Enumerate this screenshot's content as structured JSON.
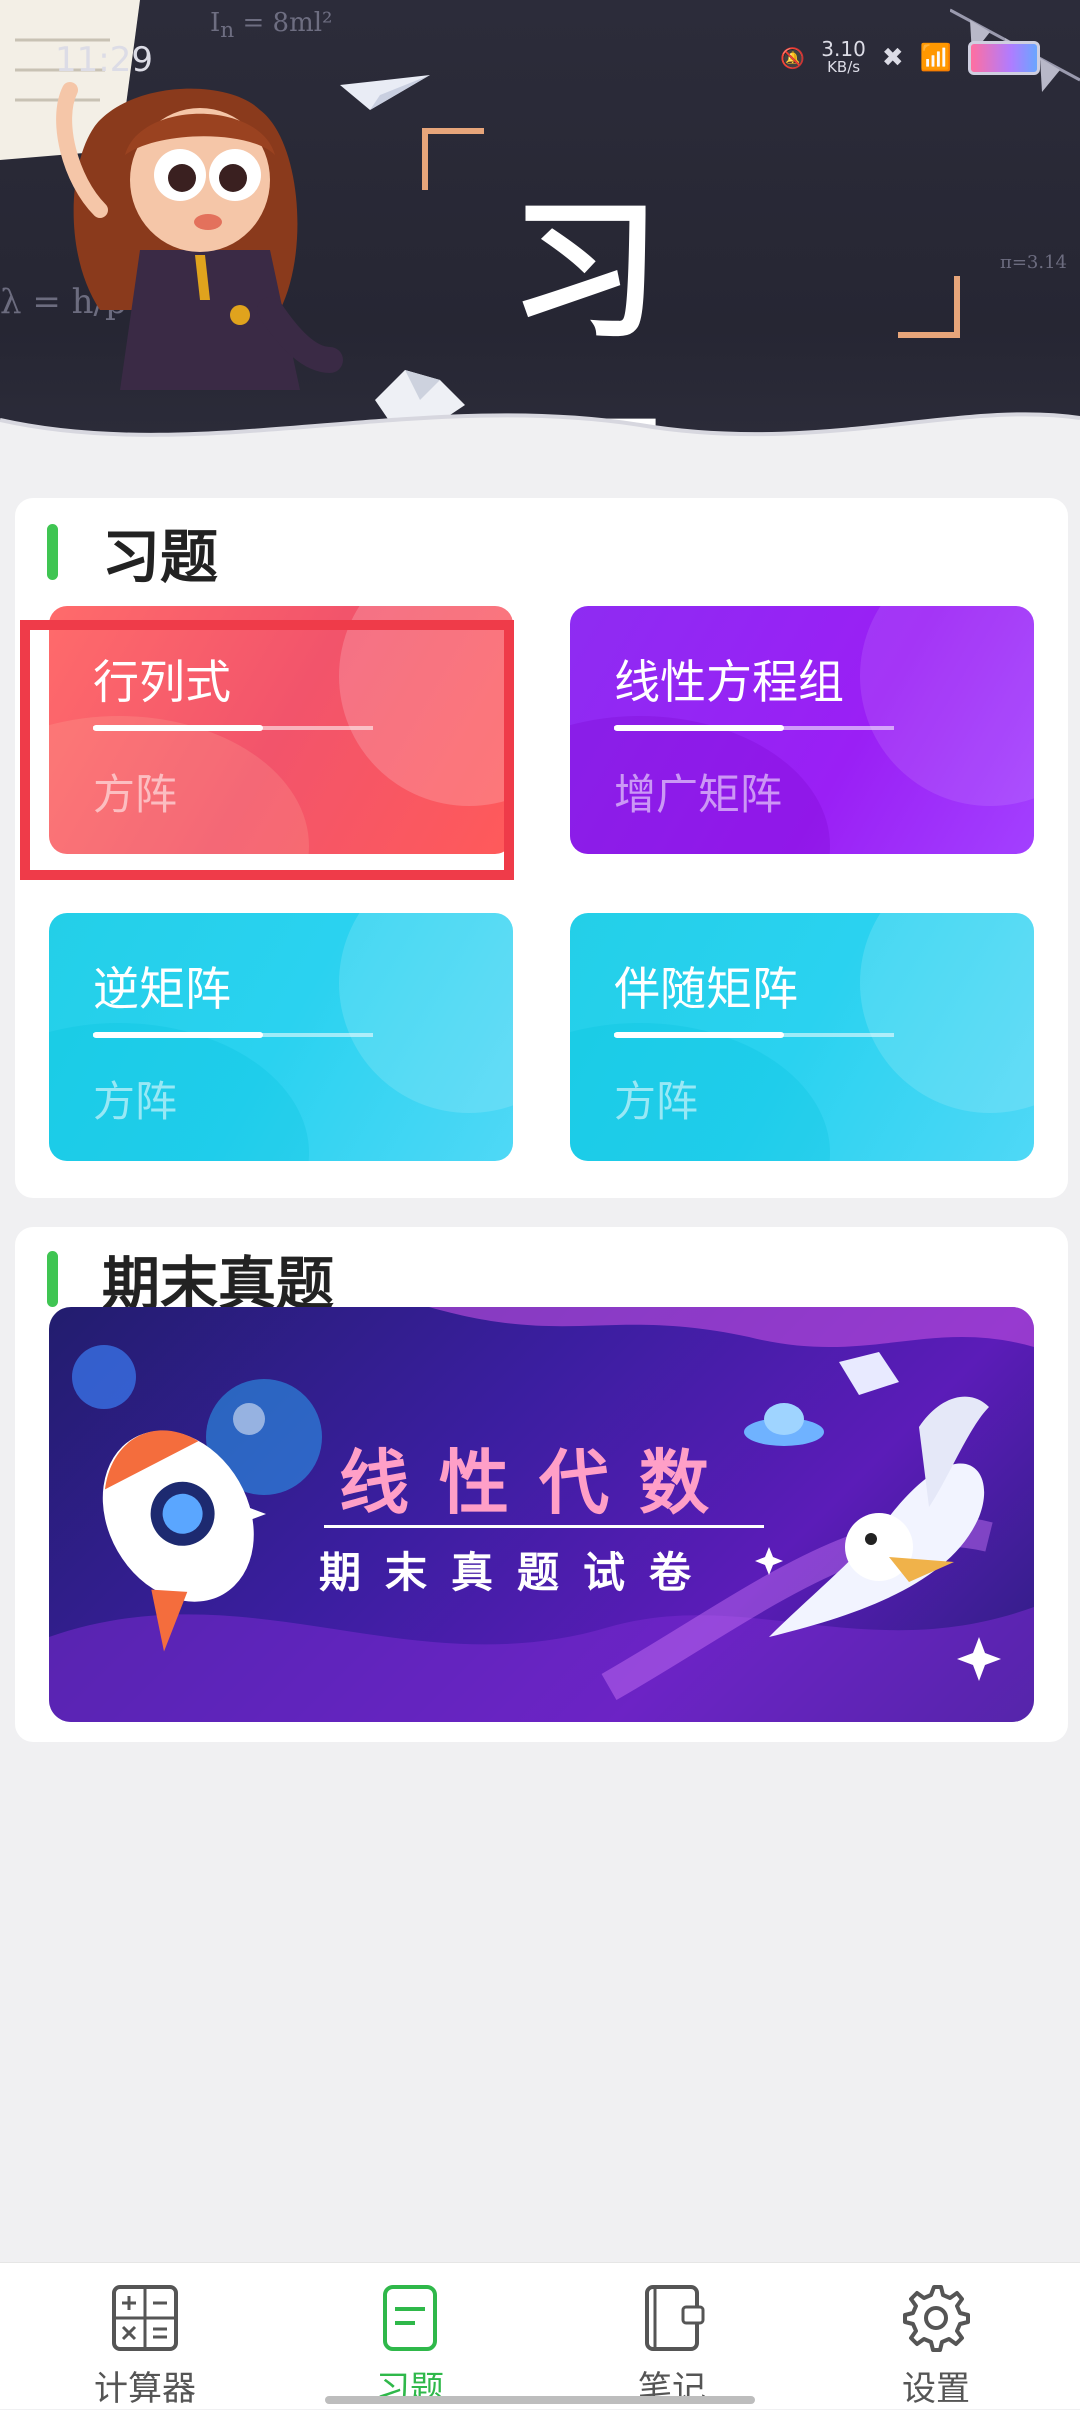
{
  "status_bar": {
    "time": "11:29",
    "net_speed": "3.10",
    "net_unit": "KB/s"
  },
  "banner": {
    "title": "习 题"
  },
  "exercises": {
    "title": "习题",
    "tiles": [
      {
        "title": "行列式",
        "subtitle": "方阵"
      },
      {
        "title": "线性方程组",
        "subtitle": "增广矩阵"
      },
      {
        "title": "逆矩阵",
        "subtitle": "方阵"
      },
      {
        "title": "伴随矩阵",
        "subtitle": "方阵"
      }
    ]
  },
  "finals": {
    "title": "期末真题",
    "banner_title": "线性代数",
    "banner_subtitle": "期末真题试卷"
  },
  "nav": {
    "items": [
      {
        "label": "计算器",
        "icon": "calculator-icon"
      },
      {
        "label": "习题",
        "icon": "exercise-icon"
      },
      {
        "label": "笔记",
        "icon": "notebook-icon"
      },
      {
        "label": "设置",
        "icon": "gear-icon"
      }
    ],
    "active_index": 1
  },
  "colors": {
    "accent_green": "#3fc552",
    "tile_red": "#f2546b",
    "tile_purple": "#9a1ff5",
    "tile_cyan": "#2ad2f0",
    "highlight_red": "#ef3b49"
  }
}
